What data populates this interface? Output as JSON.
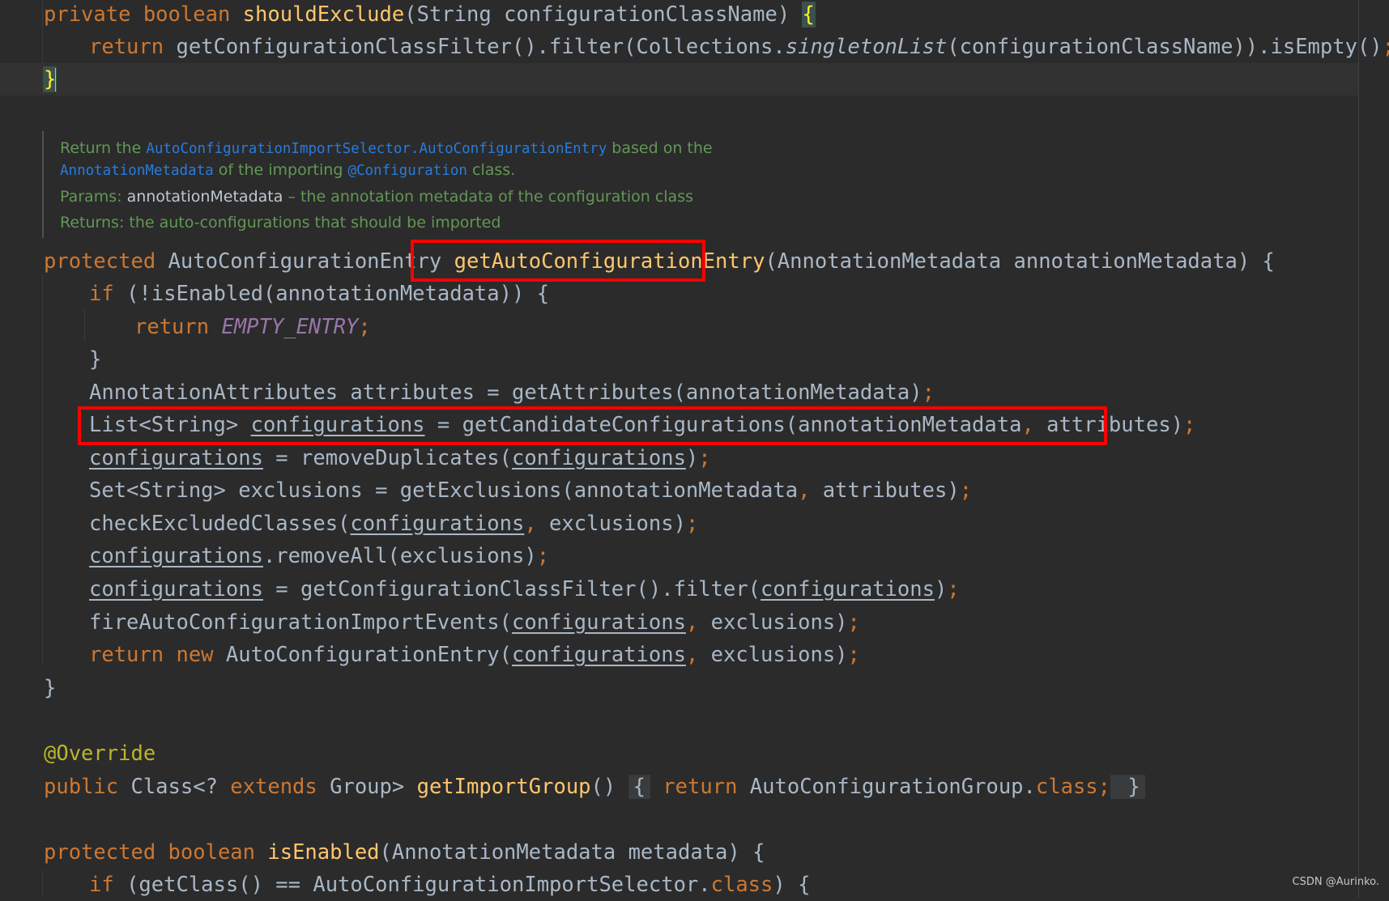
{
  "code": {
    "l1": {
      "kw1": "private ",
      "kw2": "boolean ",
      "fn": "shouldExclude",
      "rest": "(String configurationClassName) ",
      "brace": "{"
    },
    "l2": {
      "kw": "return ",
      "a": "getConfigurationClassFilter().filter(Collections.",
      "it": "singletonList",
      "b": "(configurationClassName)).isEmpty()",
      "semi": ";"
    },
    "l3": {
      "brace": "}"
    },
    "doc": {
      "r1_a": "Return the ",
      "r1_code": "AutoConfigurationImportSelector.AutoConfigurationEntry",
      "r1_b": " based on the",
      "r2_code1": "AnnotationMetadata",
      "r2_a": " of the importing ",
      "r2_code2": "@Configuration",
      "r2_b": " class.",
      "r3_a": "Params: ",
      "r3_param": "annotationMetadata",
      "r3_b": " – the annotation metadata of the configuration class",
      "r4": "Returns: the auto-configurations that should be imported"
    },
    "l4": {
      "kw": "protected ",
      "type": "AutoConfigurationEntry ",
      "fn": "getAutoConfigurationEntry",
      "rest": "(AnnotationMetadata annotationMetadata) {"
    },
    "l5": {
      "kw": "if ",
      "rest": "(!isEnabled(annotationMetadata)) {"
    },
    "l6": {
      "kw": "return ",
      "const": "EMPTY_ENTRY",
      "semi": ";"
    },
    "l7": {
      "text": "}"
    },
    "l8": {
      "a": "AnnotationAttributes attributes = getAttributes(annotationMetadata)",
      "semi": ";"
    },
    "l9": {
      "a": "List<String> ",
      "var": "configurations",
      "b": " = getCandidateConfigurations(annotationMetadata",
      "comma": ",",
      "c": " attributes)",
      "semi": ";"
    },
    "l10": {
      "var1": "configurations",
      "a": " = removeDuplicates(",
      "var2": "configurations",
      "b": ")",
      "semi": ";"
    },
    "l11": {
      "a": "Set<String> exclusions = getExclusions(annotationMetadata",
      "comma": ",",
      "b": " attributes)",
      "semi": ";"
    },
    "l12": {
      "a": "checkExcludedClasses(",
      "var": "configurations",
      "comma": ",",
      "b": " exclusions)",
      "semi": ";"
    },
    "l13": {
      "var": "configurations",
      "a": ".removeAll(exclusions)",
      "semi": ";"
    },
    "l14": {
      "var1": "configurations",
      "a": " = getConfigurationClassFilter().filter(",
      "var2": "configurations",
      "b": ")",
      "semi": ";"
    },
    "l15": {
      "a": "fireAutoConfigurationImportEvents(",
      "var": "configurations",
      "comma": ",",
      "b": " exclusions)",
      "semi": ";"
    },
    "l16": {
      "kw": "return new ",
      "a": "AutoConfigurationEntry(",
      "var": "configurations",
      "comma": ",",
      "b": " exclusions)",
      "semi": ";"
    },
    "l17": {
      "text": "}"
    },
    "l18": {
      "ann": "@Override"
    },
    "l19": {
      "kw1": "public ",
      "a": "Class<? ",
      "kw2": "extends ",
      "b": "Group> ",
      "fn": "getImportGroup",
      "c": "() ",
      "fold_open": "{",
      "kw3": " return ",
      "d": "AutoConfigurationGroup.",
      "kw4": "class",
      "semi": ";",
      "fold_close": " }"
    },
    "l20": {
      "kw1": "protected ",
      "kw2": "boolean ",
      "fn": "isEnabled",
      "rest": "(AnnotationMetadata metadata) {"
    },
    "l21": {
      "kw": "if ",
      "a": "(getClass() == AutoConfigurationImportSelector.",
      "kw2": "class",
      "b": ") {"
    }
  },
  "watermark": "CSDN @Aurinko.",
  "colors": {
    "background": "#2b2b2b",
    "keyword": "#cc7832",
    "function": "#ffc66d",
    "text": "#a9b7c6",
    "doc": "#629755",
    "highlight_box": "#ff0000"
  }
}
